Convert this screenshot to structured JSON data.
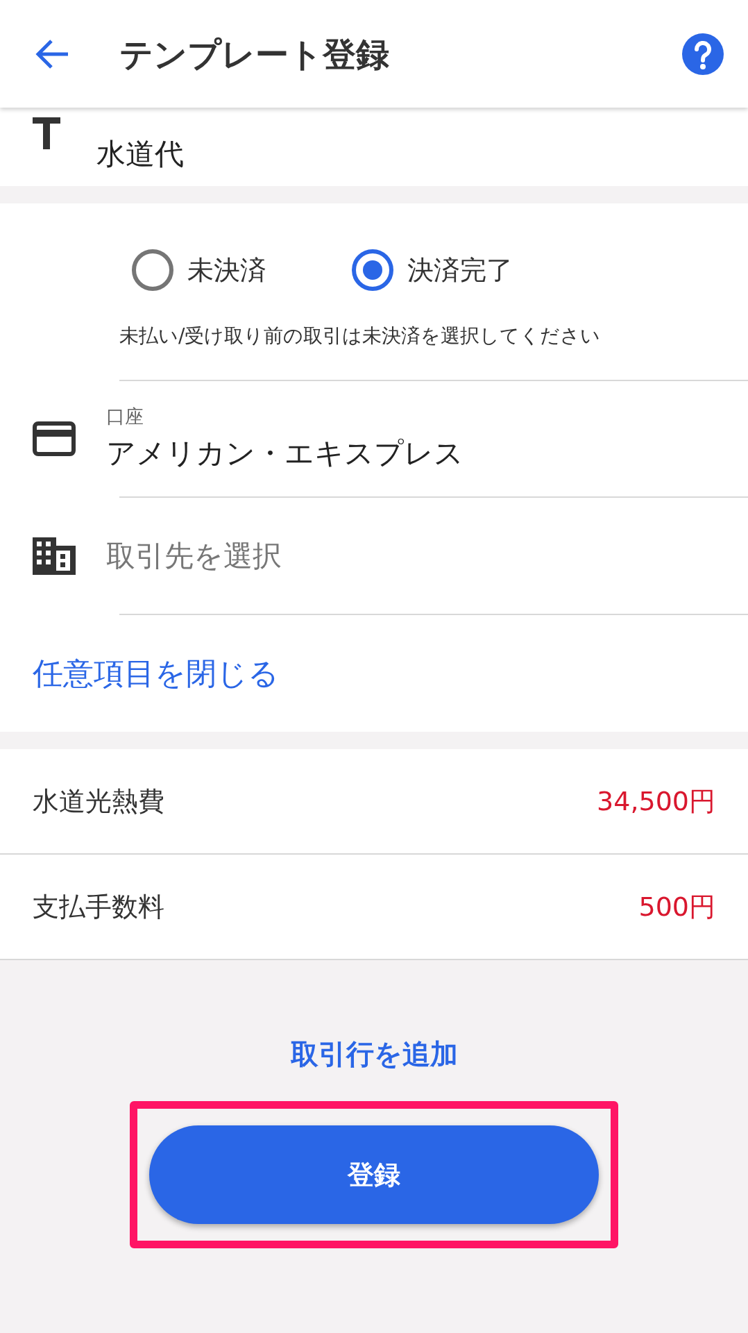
{
  "header": {
    "title": "テンプレート登録"
  },
  "template_name": {
    "value": "水道代"
  },
  "settlement": {
    "options": [
      {
        "label": "未決済",
        "selected": false
      },
      {
        "label": "決済完了",
        "selected": true
      }
    ],
    "hint": "未払い/受け取り前の取引は未決済を選択してください"
  },
  "account": {
    "label": "口座",
    "value": "アメリカン・エキスプレス"
  },
  "partner": {
    "placeholder": "取引先を選択"
  },
  "optional_toggle": "任意項目を閉じる",
  "lines": [
    {
      "category": "水道光熱費",
      "amount": "34,500円"
    },
    {
      "category": "支払手数料",
      "amount": "500円"
    }
  ],
  "add_line": "取引行を追加",
  "submit": {
    "label": "登録",
    "highlighted": true
  }
}
